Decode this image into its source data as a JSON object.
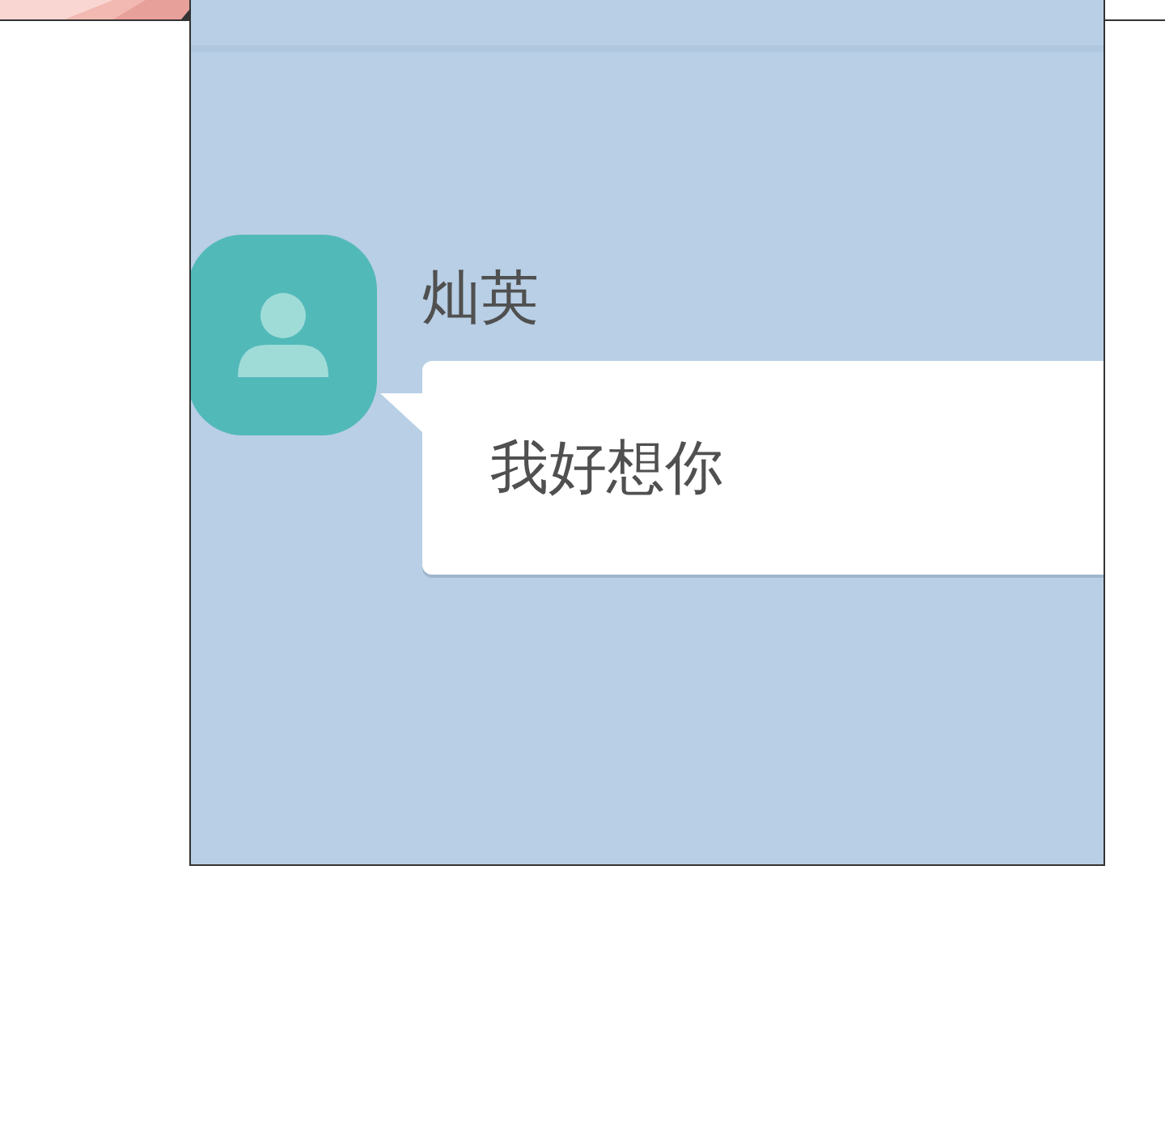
{
  "chat": {
    "contact_name": "灿英",
    "messages": [
      {
        "text": "我好想你"
      }
    ]
  }
}
